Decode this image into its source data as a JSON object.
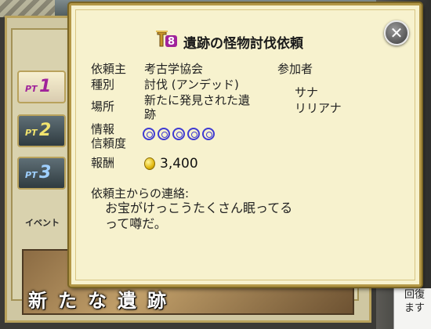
{
  "background": {
    "tabs": [
      {
        "prefix": "PT",
        "number": "1"
      },
      {
        "prefix": "PT",
        "number": "2"
      },
      {
        "prefix": "PT",
        "number": "3"
      }
    ],
    "event_label": "イベント",
    "event_banner": "新たな遺跡",
    "right_panel_text": "回復\nます"
  },
  "dialog": {
    "rank_number": "8",
    "title": "遺跡の怪物討伐依頼",
    "close_icon": "close-x",
    "fields": {
      "client_label": "依頼主",
      "client_value": "考古学協会",
      "type_label": "種別",
      "type_value": "討伐 (アンデッド)",
      "location_label": "場所",
      "location_value_line1": "新たに発見された遺",
      "location_value_line2": "跡",
      "reliability_label_line1": "情報",
      "reliability_label_line2": "信頼度",
      "reliability_count": 5,
      "reward_label": "報酬",
      "reward_value": "3,400",
      "reward_icon": "gold-coin"
    },
    "participants": {
      "label": "参加者",
      "members": [
        "サナ",
        "リリアナ"
      ]
    },
    "message": {
      "label": "依頼主からの連絡:",
      "body_line1": "お宝がけっこうたくさん眠ってる",
      "body_line2": "って噂だ。"
    }
  }
}
